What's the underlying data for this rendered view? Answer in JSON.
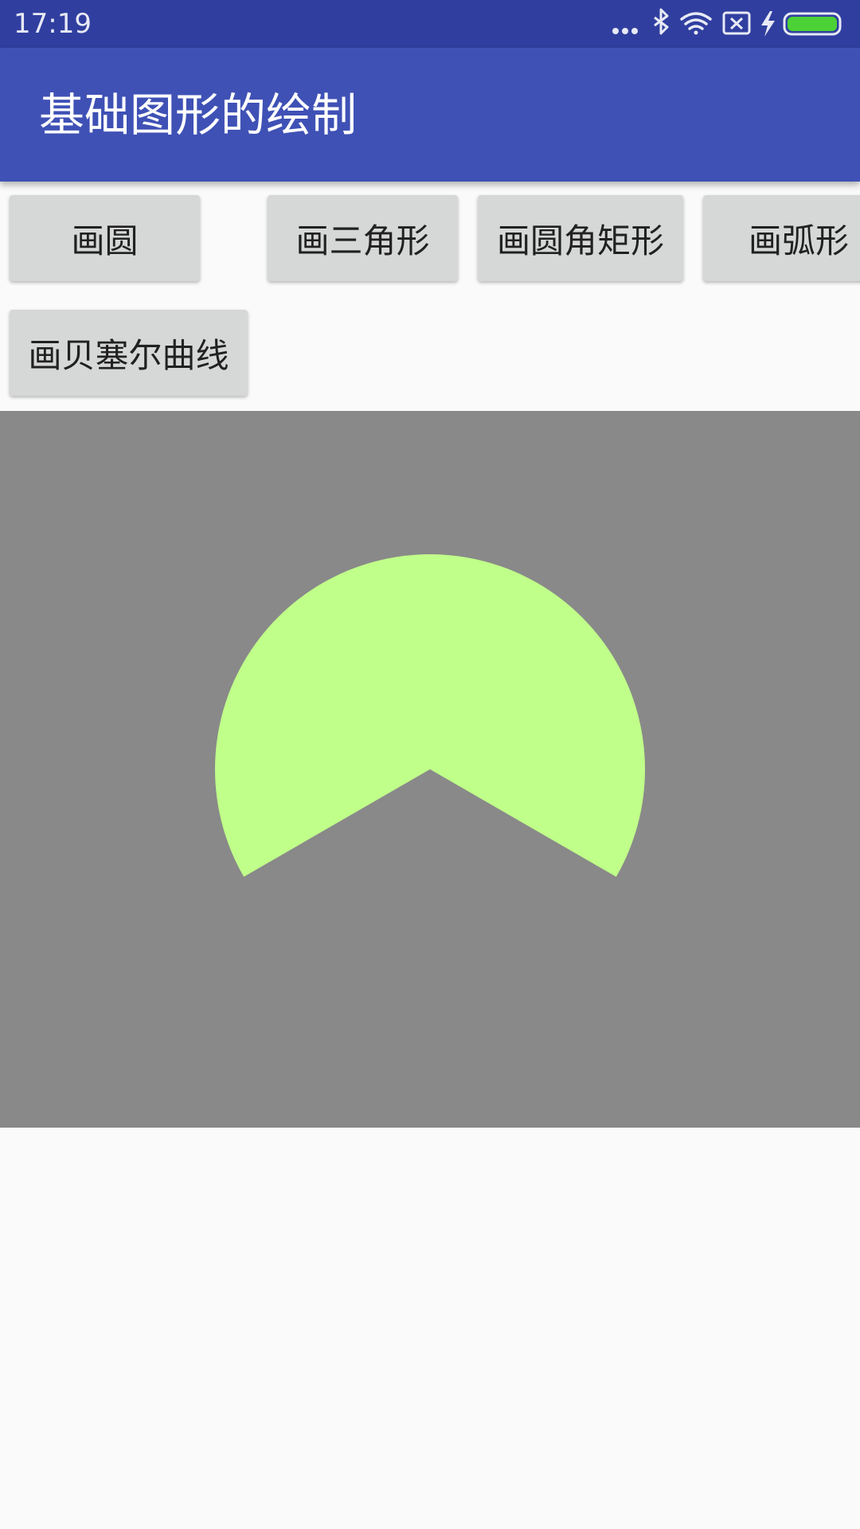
{
  "status_bar": {
    "time": "17:19",
    "icons": [
      "more-dots-icon",
      "bluetooth-icon",
      "wifi-icon",
      "sim-error-icon",
      "charging-icon",
      "battery-icon"
    ]
  },
  "app_bar": {
    "title": "基础图形的绘制"
  },
  "buttons": {
    "draw_circle": "画圆",
    "draw_triangle": "画三角形",
    "draw_round_rect": "画圆角矩形",
    "draw_arc": "画弧形",
    "draw_bezier": "画贝塞尔曲线"
  },
  "canvas": {
    "background_color": "#898989",
    "shape": "sector",
    "fill_color": "#c0ff8a",
    "sweep_angle_deg": 240,
    "start_angle_deg": 150
  },
  "colors": {
    "status_bar": "#303f9f",
    "app_bar": "#3f51b5",
    "page_background": "#fafafa",
    "button": "#d6d7d7"
  }
}
